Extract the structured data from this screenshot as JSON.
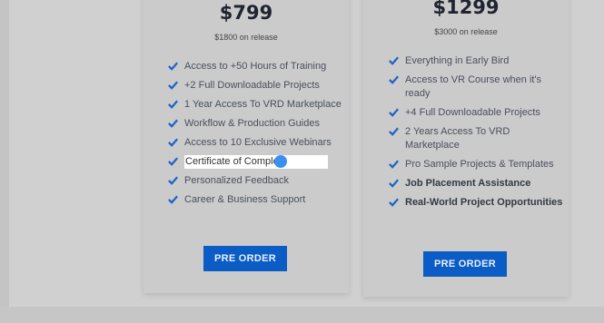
{
  "plans": [
    {
      "price": "$799",
      "release_price": "$1800 on release",
      "features": [
        "Access to +50 Hours of Training",
        "+2 Full Downloadable Projects",
        "1 Year Access To VRD Marketplace",
        "Workflow & Production Guides",
        "Access to 10 Exclusive Webinars",
        "Certificate of Comple  n",
        "Personalized Feedback",
        "Career & Business Support"
      ],
      "button": "PRE ORDER"
    },
    {
      "price": "$1299",
      "release_price": "$3000 on release",
      "features": [
        "Everything in Early Bird",
        "Access to VR Course when it's ready",
        "+4 Full Downloadable Projects",
        "2 Years Access To VRD Marketplace",
        "Pro Sample Projects & Templates",
        "Job Placement Assistance",
        "Real-World Project Opportunities"
      ],
      "button": "PRE ORDER"
    }
  ],
  "colors": {
    "accent": "#0b5cc4",
    "check": "#1f63c6",
    "overlay": "#d0d0d0",
    "cursor": "#3b8ff0"
  },
  "icons": {
    "check": "check-icon",
    "cursor": "cursor-dot-icon"
  }
}
